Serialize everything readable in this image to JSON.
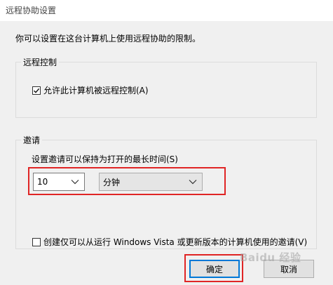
{
  "window": {
    "title": "远程协助设置"
  },
  "intro_text": "你可以设置在这台计算机上使用远程协助的限制。",
  "remote_control": {
    "group_label": "远程控制",
    "allow_label": "允许此计算机被远程控制(A)",
    "allow_checked": true
  },
  "invitations": {
    "group_label": "邀请",
    "time_label": "设置邀请可以保持为打开的最长时间(S)",
    "time_value": "10",
    "time_unit": "分钟",
    "vista_label": "创建仅可以从运行 Windows Vista 或更新版本的计算机使用的邀请(V)",
    "vista_checked": false
  },
  "buttons": {
    "ok": "确定",
    "cancel": "取消"
  },
  "watermark": "Baidu 经验",
  "colors": {
    "highlight": "#e02525",
    "focus_border": "#0078d7",
    "dialog_bg": "#f0f0f0"
  }
}
